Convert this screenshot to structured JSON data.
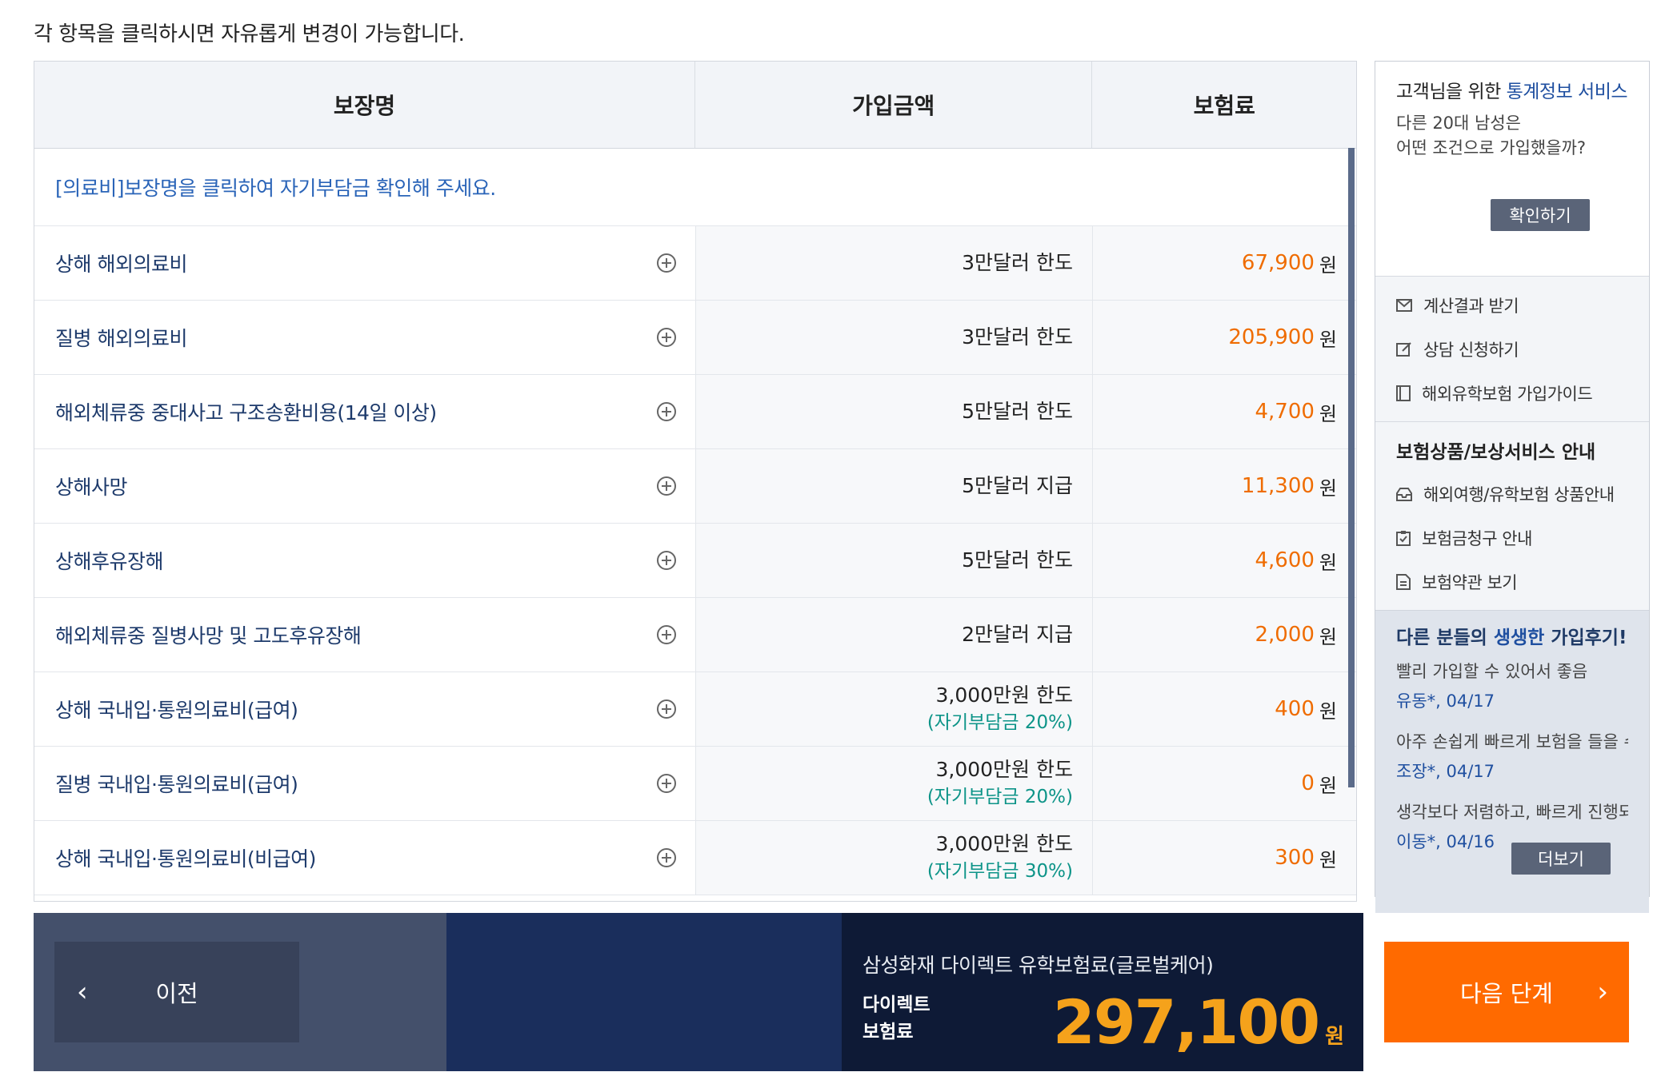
{
  "notice": "각 항목을 클릭하시면 자유롭게 변경이 가능합니다.",
  "table": {
    "headers": [
      "보장명",
      "가입금액",
      "보험료"
    ],
    "info": "[의료비]보장명을 클릭하여 자기부담금 확인해 주세요.",
    "currency": "원",
    "rows": [
      {
        "name": "상해 해외의료비",
        "amount": "3만달러 한도",
        "sub": "",
        "premium": "67,900"
      },
      {
        "name": "질병 해외의료비",
        "amount": "3만달러 한도",
        "sub": "",
        "premium": "205,900"
      },
      {
        "name": "해외체류중 중대사고 구조송환비용(14일 이상)",
        "amount": "5만달러 한도",
        "sub": "",
        "premium": "4,700"
      },
      {
        "name": "상해사망",
        "amount": "5만달러 지급",
        "sub": "",
        "premium": "11,300"
      },
      {
        "name": "상해후유장해",
        "amount": "5만달러 한도",
        "sub": "",
        "premium": "4,600"
      },
      {
        "name": "해외체류중 질병사망 및 고도후유장해",
        "amount": "2만달러 지급",
        "sub": "",
        "premium": "2,000"
      },
      {
        "name": "상해 국내입·통원의료비(급여)",
        "amount": "3,000만원 한도",
        "sub": "(자기부담금 20%)",
        "premium": "400"
      },
      {
        "name": "질병 국내입·통원의료비(급여)",
        "amount": "3,000만원 한도",
        "sub": "(자기부담금 20%)",
        "premium": "0"
      },
      {
        "name": "상해 국내입·통원의료비(비급여)",
        "amount": "3,000만원 한도",
        "sub": "(자기부담금 30%)",
        "premium": "300"
      }
    ]
  },
  "side": {
    "stats_title_pre": "고객님을 위한 ",
    "stats_title_hl": "통계정보 서비스",
    "stats_desc_1": "다른 20대 남성은",
    "stats_desc_2": "어떤 조건으로 가입했을까?",
    "confirm_label": "확인하기",
    "links": [
      {
        "icon": "mail-icon",
        "label": "계산결과 받기"
      },
      {
        "icon": "edit-icon",
        "label": "상담 신청하기"
      },
      {
        "icon": "guide-icon",
        "label": "해외유학보험 가입가이드"
      }
    ],
    "section_title": "보험상품/보상서비스 안내",
    "section_links": [
      {
        "icon": "inbox-icon",
        "label": "해외여행/유학보험 상품안내"
      },
      {
        "icon": "clipboard-icon",
        "label": "보험금청구 안내"
      },
      {
        "icon": "document-icon",
        "label": "보험약관 보기"
      }
    ],
    "reviews_title_pre": "다른 분들의 ",
    "reviews_title_hl": "생생한",
    "reviews_title_post": " 가입후기!",
    "reviews": [
      {
        "text": "빨리 가입할 수 있어서 좋음",
        "meta": "유동*, 04/17"
      },
      {
        "text": "아주 손쉽게 빠르게 보험을 들을 수",
        "meta": "조장*, 04/17"
      },
      {
        "text": "생각보다 저렴하고, 빠르게 진행되",
        "meta": "이동*, 04/16"
      }
    ],
    "more_label": "더보기"
  },
  "bottom": {
    "prev_label": "이전",
    "product": "삼성화재 다이렉트 유학보험료(글로벌케어)",
    "label_1": "다이렉트",
    "label_2": "보험료",
    "total": "297,100",
    "currency": "원",
    "next_label": "다음 단계"
  },
  "colors": {
    "accent": "#ff6a00",
    "premium": "#ef6c00",
    "total": "#f5a21b",
    "link": "#2a64b8"
  }
}
